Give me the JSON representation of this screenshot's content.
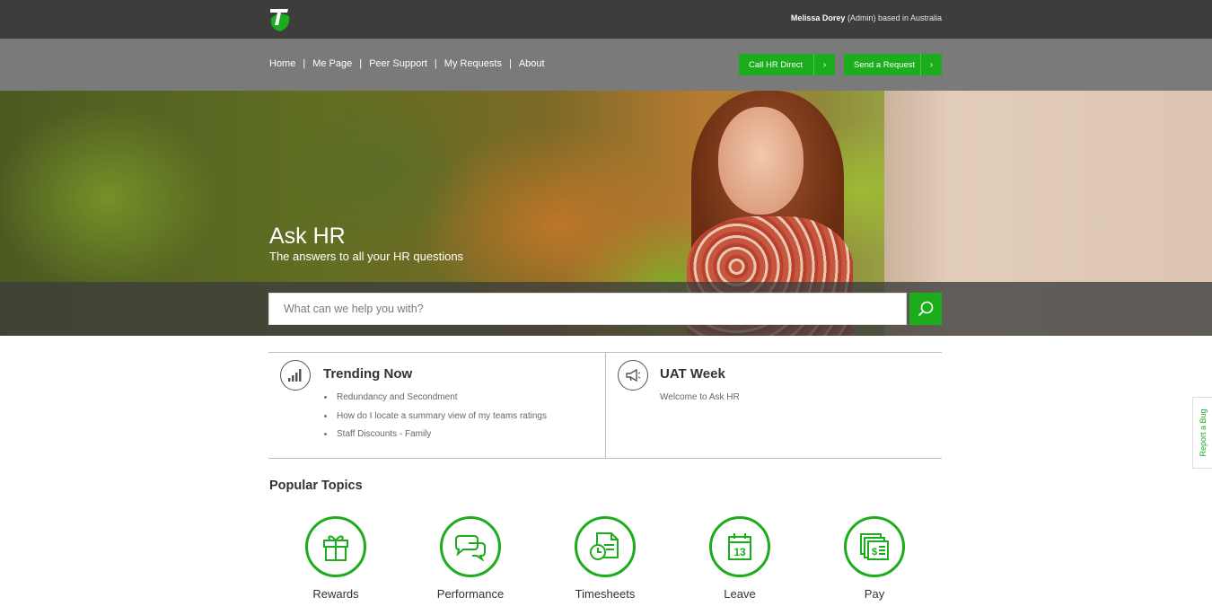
{
  "header": {
    "user_name": "Melissa Dorey",
    "user_role_location": "(Admin) based in Australia"
  },
  "nav": {
    "items": [
      "Home",
      "Me Page",
      "Peer Support",
      "My Requests",
      "About"
    ],
    "call_button": "Call HR Direct",
    "send_button": "Send a Request"
  },
  "hero": {
    "title": "Ask HR",
    "subtitle": "The answers to all your HR questions"
  },
  "search": {
    "placeholder": "What can we help you with?"
  },
  "trending": {
    "title": "Trending Now",
    "items": [
      "Redundancy and Secondment",
      "How do I locate a summary view of my teams ratings",
      "Staff Discounts - Family"
    ]
  },
  "uat": {
    "title": "UAT Week",
    "text": "Welcome to Ask HR"
  },
  "popular": {
    "title": "Popular Topics",
    "topics": [
      {
        "label": "Rewards",
        "icon": "gift-icon"
      },
      {
        "label": "Performance",
        "icon": "chat-bubbles-icon"
      },
      {
        "label": "Timesheets",
        "icon": "timesheet-clock-icon"
      },
      {
        "label": "Leave",
        "icon": "calendar-icon"
      },
      {
        "label": "Pay",
        "icon": "payslip-icon"
      }
    ]
  },
  "report_bug": "Report a Bug",
  "colors": {
    "accent": "#1bad1b",
    "topbar": "#3d3d3d",
    "navbar": "#7a7a7a"
  }
}
